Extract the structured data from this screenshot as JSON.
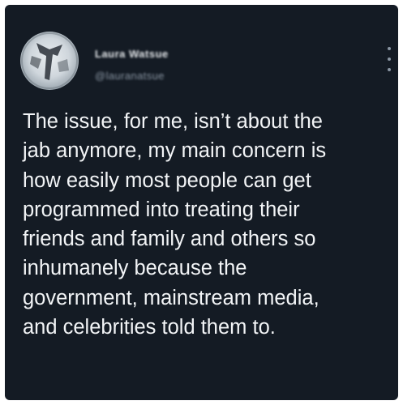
{
  "tweet": {
    "author_name": "Laura Watsue",
    "author_handle": "@lauranatsue",
    "avatar": "profile-photo",
    "more_icon": "more-vertical-icon",
    "text_lines": [
      "The issue, for me, isn’t about the",
      "jab anymore, my main concern is",
      "how easily most people can get",
      "programmed into treating their",
      "friends and family and others so",
      "inhumanely because the",
      "government, mainstream media,",
      "and celebrities told them to."
    ]
  },
  "colors": {
    "background": "#141b24",
    "text": "#f2f4f6",
    "secondary_text": "#8a96a3"
  }
}
